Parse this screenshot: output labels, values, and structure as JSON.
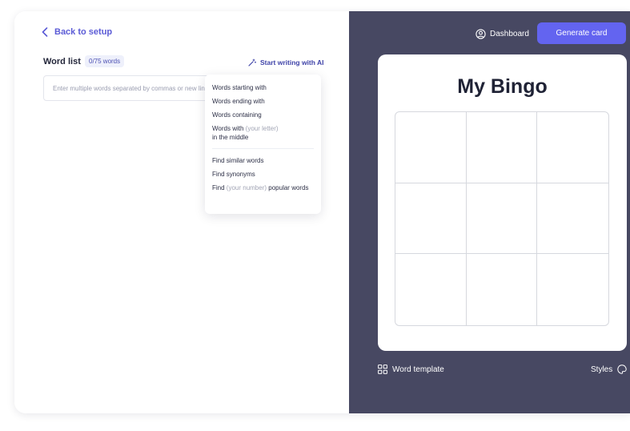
{
  "left": {
    "back_label": "Back to setup",
    "word_list_title": "Word list",
    "word_count_badge": "0/75 words",
    "ai_link_label": "Start writing with AI",
    "input_placeholder": "Enter multiple words separated by commas or new lines",
    "input_value": ""
  },
  "menu": {
    "starting_with": "Words starting with",
    "ending_with": "Words ending with",
    "containing": "Words containing",
    "with_prefix": "Words with",
    "your_letter": "(your letter)",
    "in_the_middle": "in the middle",
    "find_similar": "Find similar words",
    "find_synonyms": "Find synonyms",
    "find_prefix": "Find",
    "your_number": "(your number)",
    "popular_words": "popular words"
  },
  "right": {
    "dashboard_label": "Dashboard",
    "generate_label": "Generate card",
    "card_title": "My Bingo",
    "grid_size": 3,
    "word_template_label": "Word template",
    "styles_label": "Styles"
  },
  "colors": {
    "accent": "#6364f0",
    "link": "#5b5bd6",
    "right_panel_bg": "#474862"
  },
  "icons": {
    "back": "chevron-left-icon",
    "ai": "magic-wand-icon",
    "dashboard": "user-circle-icon",
    "word_template": "grid-icon",
    "styles": "palette-icon"
  }
}
